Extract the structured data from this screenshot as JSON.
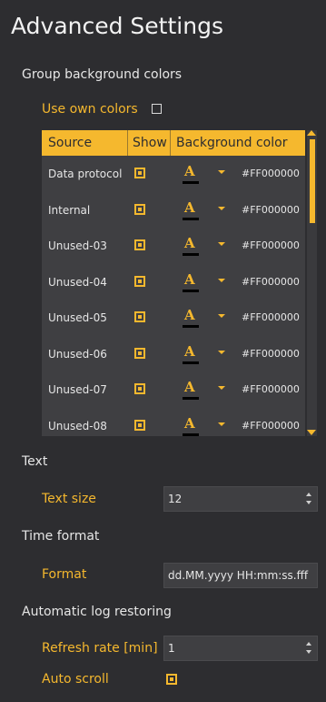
{
  "title": "Advanced Settings",
  "group_bg": {
    "heading": "Group background colors",
    "use_own_colors_label": "Use own colors",
    "use_own_colors_checked": false,
    "columns": [
      "Source",
      "Show",
      "Background color"
    ],
    "rows": [
      {
        "source": "Data protocol",
        "show": true,
        "font_icon": "A",
        "color_hex": "#FF000000"
      },
      {
        "source": "Internal",
        "show": true,
        "font_icon": "A",
        "color_hex": "#FF000000"
      },
      {
        "source": "Unused-03",
        "show": true,
        "font_icon": "A",
        "color_hex": "#FF000000"
      },
      {
        "source": "Unused-04",
        "show": true,
        "font_icon": "A",
        "color_hex": "#FF000000"
      },
      {
        "source": "Unused-05",
        "show": true,
        "font_icon": "A",
        "color_hex": "#FF000000"
      },
      {
        "source": "Unused-06",
        "show": true,
        "font_icon": "A",
        "color_hex": "#FF000000"
      },
      {
        "source": "Unused-07",
        "show": true,
        "font_icon": "A",
        "color_hex": "#FF000000"
      },
      {
        "source": "Unused-08",
        "show": true,
        "font_icon": "A",
        "color_hex": "#FF000000"
      }
    ]
  },
  "text_section": {
    "heading": "Text",
    "text_size_label": "Text size",
    "text_size_value": "12"
  },
  "time_section": {
    "heading": "Time format",
    "format_label": "Format",
    "format_value": "dd.MM.yyyy HH:mm:ss.fff"
  },
  "log_section": {
    "heading": "Automatic log restoring",
    "refresh_label": "Refresh rate [min]",
    "refresh_value": "1",
    "auto_scroll_label": "Auto scroll",
    "auto_scroll_checked": true
  },
  "colors": {
    "accent": "#f5b82e",
    "background": "#2d2d30",
    "panel": "#3f3f42"
  }
}
